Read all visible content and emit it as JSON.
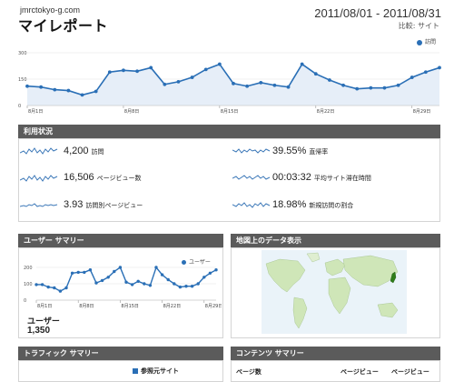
{
  "header": {
    "site": "jmrctokyo-g.com",
    "title": "マイレポート",
    "date_range": "2011/08/01 - 2011/08/31",
    "compare": "比較: サイト"
  },
  "main_chart": {
    "legend": "訪問",
    "accent": "#2a6fb6",
    "fill": "#e6eef8"
  },
  "chart_data": [
    {
      "type": "area",
      "series": [
        {
          "name": "訪問",
          "values": [
            110,
            105,
            90,
            85,
            60,
            80,
            190,
            200,
            195,
            215,
            120,
            135,
            160,
            205,
            235,
            125,
            110,
            130,
            115,
            105,
            235,
            180,
            145,
            115,
            95,
            100,
            100,
            115,
            160,
            190,
            215
          ]
        }
      ],
      "x": [
        "8月1日",
        "8月2日",
        "8月3日",
        "8月4日",
        "8月5日",
        "8月6日",
        "8月7日",
        "8月8日",
        "8月9日",
        "8月10日",
        "8月11日",
        "8月12日",
        "8月13日",
        "8月14日",
        "8月15日",
        "8月16日",
        "8月17日",
        "8月18日",
        "8月19日",
        "8月20日",
        "8月21日",
        "8月22日",
        "8月23日",
        "8月24日",
        "8月25日",
        "8月26日",
        "8月27日",
        "8月28日",
        "8月29日",
        "8月30日",
        "8月31日"
      ],
      "xticks": [
        "8月1日",
        "8月8日",
        "8月15日",
        "8月22日",
        "8月29日"
      ],
      "yticks": [
        "300",
        "150",
        "0"
      ],
      "ylim": [
        0,
        300
      ],
      "legend": "top-right",
      "grid": true
    },
    {
      "type": "line",
      "series": [
        {
          "name": "ユーザー",
          "values": [
            95,
            95,
            80,
            75,
            55,
            75,
            165,
            170,
            170,
            185,
            105,
            120,
            140,
            175,
            200,
            110,
            95,
            115,
            100,
            90,
            200,
            155,
            125,
            100,
            80,
            85,
            85,
            100,
            140,
            165,
            185
          ]
        }
      ],
      "x": [
        "8月1日",
        "8月2日",
        "8月3日",
        "8月4日",
        "8月5日",
        "8月6日",
        "8月7日",
        "8月8日",
        "8月9日",
        "8月10日",
        "8月11日",
        "8月12日",
        "8月13日",
        "8月14日",
        "8月15日",
        "8月16日",
        "8月17日",
        "8月18日",
        "8月19日",
        "8月20日",
        "8月21日",
        "8月22日",
        "8月23日",
        "8月24日",
        "8月25日",
        "8月26日",
        "8月27日",
        "8月28日",
        "8月29日",
        "8月30日",
        "8月31日"
      ],
      "xticks": [
        "8月1日",
        "8月8日",
        "8月15日",
        "8月22日",
        "8月29日"
      ],
      "yticks": [
        "200",
        "100",
        "0"
      ],
      "ylim": [
        0,
        200
      ],
      "legend": "top-right",
      "grid": true
    }
  ],
  "usage": {
    "title": "利用状況",
    "stats": [
      {
        "value": "4,200",
        "label": "訪問"
      },
      {
        "value": "39.55%",
        "label": "直帰率"
      },
      {
        "value": "16,506",
        "label": "ページビュー数"
      },
      {
        "value": "00:03:32",
        "label": "平均サイト滞在時間"
      },
      {
        "value": "3.93",
        "label": "訪問別ページビュー"
      },
      {
        "value": "18.98%",
        "label": "新規訪問の割合"
      }
    ]
  },
  "users": {
    "title": "ユーザー サマリー",
    "legend": "ユーザー",
    "label": "ユーザー",
    "value": "1,350"
  },
  "map": {
    "title": "地図上のデータ表示"
  },
  "traffic": {
    "title": "トラフィック サマリー",
    "item": "参照元サイト"
  },
  "content": {
    "title": "コンテンツ サマリー",
    "col1": "ページ数",
    "col2": "ページビュー",
    "col3": "ページビュー"
  }
}
